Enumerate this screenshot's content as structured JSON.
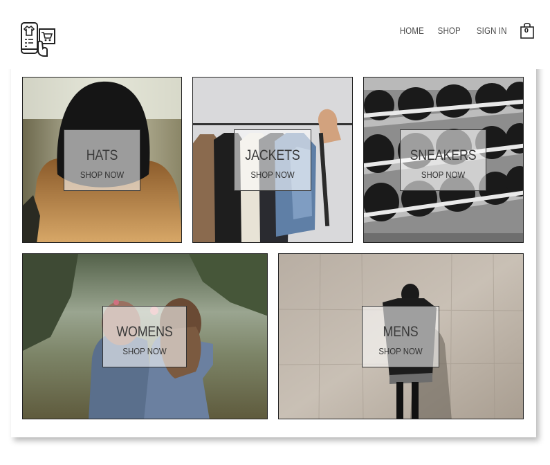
{
  "nav": {
    "home": "HOME",
    "shop": "SHOP",
    "sign_in": "SIGN IN",
    "cart_count": "0"
  },
  "icons": {
    "logo": "shop-logo-icon",
    "cart": "shopping-bag-icon"
  },
  "categories": [
    {
      "id": "hats",
      "title": "HATS",
      "cta": "SHOP NOW"
    },
    {
      "id": "jackets",
      "title": "JACKETS",
      "cta": "SHOP NOW"
    },
    {
      "id": "sneakers",
      "title": "SNEAKERS",
      "cta": "SHOP NOW"
    },
    {
      "id": "womens",
      "title": "WOMENS",
      "cta": "SHOP NOW"
    },
    {
      "id": "mens",
      "title": "MENS",
      "cta": "SHOP NOW"
    }
  ]
}
